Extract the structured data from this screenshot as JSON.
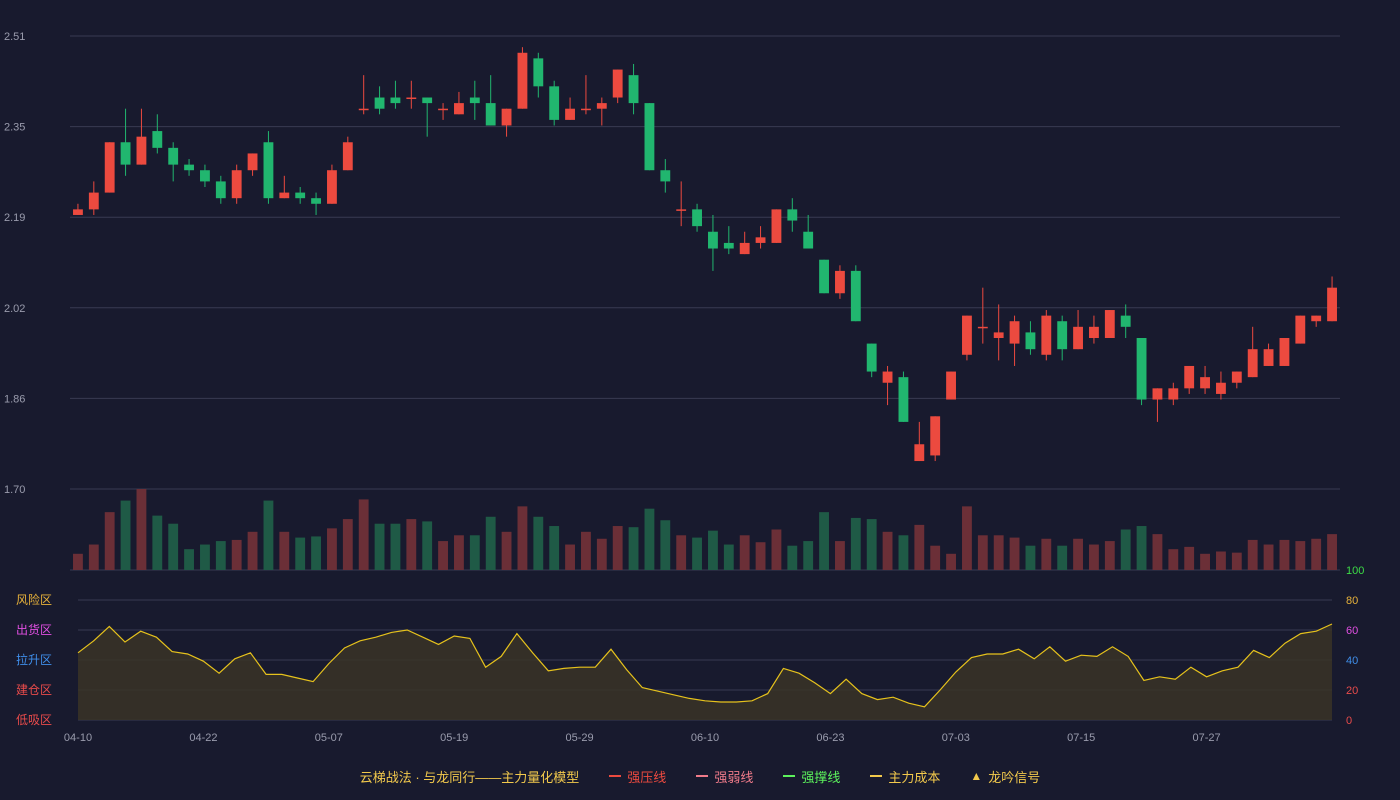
{
  "chart_data": {
    "type": "candlestick",
    "price_axis": {
      "ticks": [
        "2.51",
        "2.35",
        "2.19",
        "2.02",
        "1.86",
        "1.70"
      ],
      "ylim": [
        1.7,
        2.51
      ]
    },
    "date_ticks": [
      "04-10",
      "04-22",
      "05-07",
      "05-19",
      "05-29",
      "06-10",
      "06-23",
      "07-03",
      "07-15",
      "07-27"
    ],
    "date_tick_index": [
      0,
      8,
      16,
      24,
      32,
      40,
      48,
      56,
      64,
      72
    ],
    "ohlc": [
      [
        2.19,
        2.2,
        2.21,
        2.19
      ],
      [
        2.2,
        2.23,
        2.25,
        2.19
      ],
      [
        2.23,
        2.32,
        2.32,
        2.23
      ],
      [
        2.32,
        2.28,
        2.38,
        2.26
      ],
      [
        2.28,
        2.33,
        2.38,
        2.28
      ],
      [
        2.34,
        2.31,
        2.37,
        2.3
      ],
      [
        2.31,
        2.28,
        2.32,
        2.25
      ],
      [
        2.28,
        2.27,
        2.29,
        2.26
      ],
      [
        2.27,
        2.25,
        2.28,
        2.24
      ],
      [
        2.25,
        2.22,
        2.26,
        2.21
      ],
      [
        2.22,
        2.27,
        2.28,
        2.21
      ],
      [
        2.27,
        2.3,
        2.3,
        2.26
      ],
      [
        2.32,
        2.22,
        2.34,
        2.21
      ],
      [
        2.22,
        2.23,
        2.26,
        2.22
      ],
      [
        2.23,
        2.22,
        2.24,
        2.21
      ],
      [
        2.22,
        2.21,
        2.23,
        2.19
      ],
      [
        2.21,
        2.27,
        2.28,
        2.21
      ],
      [
        2.27,
        2.32,
        2.33,
        2.27
      ],
      [
        2.38,
        2.38,
        2.44,
        2.37
      ],
      [
        2.4,
        2.38,
        2.42,
        2.37
      ],
      [
        2.4,
        2.39,
        2.43,
        2.38
      ],
      [
        2.4,
        2.4,
        2.43,
        2.38
      ],
      [
        2.4,
        2.39,
        2.4,
        2.33
      ],
      [
        2.38,
        2.38,
        2.39,
        2.36
      ],
      [
        2.37,
        2.39,
        2.41,
        2.37
      ],
      [
        2.4,
        2.39,
        2.43,
        2.36
      ],
      [
        2.39,
        2.35,
        2.44,
        2.35
      ],
      [
        2.35,
        2.38,
        2.38,
        2.33
      ],
      [
        2.38,
        2.48,
        2.49,
        2.38
      ],
      [
        2.47,
        2.42,
        2.48,
        2.4
      ],
      [
        2.42,
        2.36,
        2.43,
        2.35
      ],
      [
        2.36,
        2.38,
        2.4,
        2.36
      ],
      [
        2.38,
        2.38,
        2.44,
        2.37
      ],
      [
        2.38,
        2.39,
        2.4,
        2.35
      ],
      [
        2.4,
        2.45,
        2.45,
        2.39
      ],
      [
        2.44,
        2.39,
        2.46,
        2.37
      ],
      [
        2.39,
        2.27,
        2.39,
        2.27
      ],
      [
        2.27,
        2.25,
        2.29,
        2.23
      ],
      [
        2.2,
        2.2,
        2.25,
        2.17
      ],
      [
        2.2,
        2.17,
        2.21,
        2.16
      ],
      [
        2.16,
        2.13,
        2.19,
        2.09
      ],
      [
        2.14,
        2.13,
        2.17,
        2.12
      ],
      [
        2.12,
        2.14,
        2.16,
        2.12
      ],
      [
        2.14,
        2.15,
        2.17,
        2.13
      ],
      [
        2.14,
        2.2,
        2.2,
        2.14
      ],
      [
        2.2,
        2.18,
        2.22,
        2.16
      ],
      [
        2.16,
        2.13,
        2.19,
        2.13
      ],
      [
        2.11,
        2.05,
        2.11,
        2.05
      ],
      [
        2.05,
        2.09,
        2.1,
        2.04
      ],
      [
        2.09,
        2.0,
        2.1,
        2.0
      ],
      [
        1.96,
        1.91,
        1.96,
        1.9
      ],
      [
        1.89,
        1.91,
        1.92,
        1.85
      ],
      [
        1.9,
        1.82,
        1.91,
        1.82
      ],
      [
        1.75,
        1.78,
        1.82,
        1.75
      ],
      [
        1.76,
        1.83,
        1.83,
        1.75
      ],
      [
        1.86,
        1.91,
        1.91,
        1.86
      ],
      [
        1.94,
        2.01,
        2.01,
        1.93
      ],
      [
        1.99,
        1.99,
        2.06,
        1.96
      ],
      [
        1.97,
        1.98,
        2.03,
        1.93
      ],
      [
        1.96,
        2.0,
        2.01,
        1.92
      ],
      [
        1.98,
        1.95,
        2.0,
        1.94
      ],
      [
        1.94,
        2.01,
        2.02,
        1.93
      ],
      [
        2.0,
        1.95,
        2.01,
        1.93
      ],
      [
        1.95,
        1.99,
        2.02,
        1.95
      ],
      [
        1.97,
        1.99,
        2.01,
        1.96
      ],
      [
        1.97,
        2.02,
        2.02,
        1.97
      ],
      [
        2.01,
        1.99,
        2.03,
        1.97
      ],
      [
        1.97,
        1.86,
        1.97,
        1.85
      ],
      [
        1.86,
        1.88,
        1.88,
        1.82
      ],
      [
        1.86,
        1.88,
        1.89,
        1.85
      ],
      [
        1.88,
        1.92,
        1.92,
        1.87
      ],
      [
        1.88,
        1.9,
        1.92,
        1.87
      ],
      [
        1.87,
        1.89,
        1.91,
        1.86
      ],
      [
        1.89,
        1.91,
        1.91,
        1.88
      ],
      [
        1.9,
        1.95,
        1.99,
        1.9
      ],
      [
        1.92,
        1.95,
        1.96,
        1.92
      ],
      [
        1.92,
        1.97,
        1.97,
        1.92
      ],
      [
        1.96,
        2.01,
        2.01,
        1.96
      ],
      [
        2.0,
        2.01,
        2.01,
        1.99
      ],
      [
        2.0,
        2.06,
        2.08,
        2.0
      ]
    ],
    "volume": [
      14,
      22,
      50,
      60,
      70,
      47,
      40,
      18,
      22,
      25,
      26,
      33,
      60,
      33,
      28,
      29,
      36,
      44,
      61,
      40,
      40,
      44,
      42,
      25,
      30,
      30,
      46,
      33,
      55,
      46,
      38,
      22,
      33,
      27,
      38,
      37,
      53,
      43,
      30,
      28,
      34,
      22,
      30,
      24,
      35,
      21,
      25,
      50,
      25,
      45,
      44,
      33,
      30,
      39,
      21,
      14,
      55,
      30,
      30,
      28,
      21,
      27,
      21,
      27,
      22,
      25,
      35,
      38,
      31,
      18,
      20,
      14,
      16,
      15,
      26,
      22,
      26,
      25,
      27,
      31
    ],
    "volume_up_color": "#6b2f37",
    "volume_down_color": "#1f5a46",
    "up_color": "#ec4a3f",
    "down_color": "#21b66f",
    "indicator": {
      "values": [
        56,
        66,
        78,
        65,
        74,
        69,
        57,
        55,
        49,
        39,
        51,
        56,
        38,
        38,
        35,
        32,
        47,
        60,
        66,
        69,
        73,
        75,
        69,
        63,
        70,
        68,
        44,
        53,
        72,
        56,
        41,
        43,
        44,
        44,
        59,
        42,
        27,
        24,
        21,
        18,
        16,
        15,
        15,
        16,
        22,
        43,
        39,
        31,
        22,
        34,
        22,
        17,
        19,
        14,
        11,
        25,
        40,
        52,
        55,
        55,
        59,
        51,
        61,
        49,
        54,
        53,
        61,
        53,
        33,
        36,
        34,
        44,
        36,
        41,
        44,
        58,
        52,
        64,
        72,
        74,
        80
      ],
      "scale_ticks": [
        "100",
        "80",
        "60",
        "40",
        "20",
        "0"
      ],
      "scale_tick_colors": [
        "#3cdc46",
        "#e8b23a",
        "#e14fe2",
        "#3f8eea",
        "#e94b4b",
        "#e94b4b"
      ],
      "zones": [
        "风险区",
        "出货区",
        "拉升区",
        "建仓区",
        "低吸区"
      ],
      "zone_colors": [
        "#e8b23a",
        "#e14fe2",
        "#3f8eea",
        "#e94b4b",
        "#e94b4b"
      ],
      "line_color": "#e6c21c",
      "ylim": [
        0,
        100
      ]
    }
  },
  "legend": {
    "title": "云梯战法 · 与龙同行——主力量化模型",
    "items": [
      {
        "label": "强压线",
        "color": "#ec4a3f",
        "style": "solid"
      },
      {
        "label": "强弱线",
        "color": "#f07b8a",
        "style": "dashed"
      },
      {
        "label": "强撑线",
        "color": "#5cf25c",
        "style": "solid"
      },
      {
        "label": "主力成本",
        "color": "#f2c94c",
        "style": "dashed"
      },
      {
        "label": "龙吟信号",
        "color": "#f2c94c",
        "style": "triangle",
        "icon": "▲"
      }
    ],
    "title_color": "#f2c94c"
  }
}
